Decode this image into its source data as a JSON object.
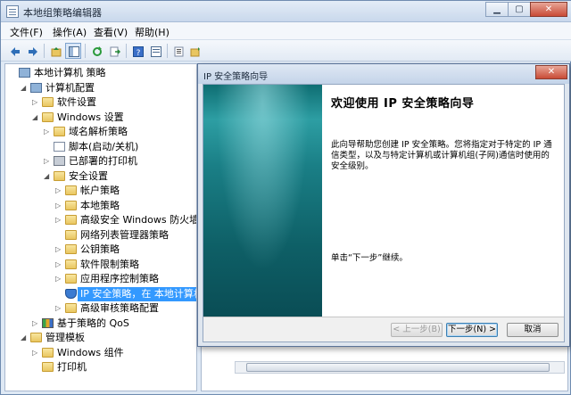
{
  "app": {
    "title": "本地组策略编辑器"
  },
  "window_buttons": {
    "minimize": "▁",
    "maximize": "▢",
    "close": "✕"
  },
  "menu": [
    "文件(F)",
    "操作(A)",
    "查看(V)",
    "帮助(H)"
  ],
  "toolbar": [
    "back-icon",
    "forward-icon",
    "up-folder-icon",
    "show-tree-icon",
    "refresh-icon",
    "export-icon",
    "help-icon",
    "properties-icon",
    "filter-icon",
    "policy-icon"
  ],
  "tree": [
    {
      "label": "本地计算机 策略",
      "icon": "computer-icon",
      "level": 0,
      "arrow": ""
    },
    {
      "label": "计算机配置",
      "icon": "computer-icon",
      "level": 1,
      "arrow": "◢"
    },
    {
      "label": "软件设置",
      "icon": "folder-icon",
      "level": 2,
      "arrow": "▷"
    },
    {
      "label": "Windows 设置",
      "icon": "folder-icon",
      "level": 2,
      "arrow": "◢"
    },
    {
      "label": "域名解析策略",
      "icon": "folder-icon",
      "level": 3,
      "arrow": "▷"
    },
    {
      "label": "脚本(启动/关机)",
      "icon": "doc-icon",
      "level": 3,
      "arrow": ""
    },
    {
      "label": "已部署的打印机",
      "icon": "printer-icon",
      "level": 3,
      "arrow": "▷"
    },
    {
      "label": "安全设置",
      "icon": "folder-icon",
      "level": 3,
      "arrow": "◢"
    },
    {
      "label": "帐户策略",
      "icon": "folder-icon",
      "level": 4,
      "arrow": "▷"
    },
    {
      "label": "本地策略",
      "icon": "folder-icon",
      "level": 4,
      "arrow": "▷"
    },
    {
      "label": "高级安全 Windows 防火墙",
      "icon": "folder-icon",
      "level": 4,
      "arrow": "▷"
    },
    {
      "label": "网络列表管理器策略",
      "icon": "folder-icon",
      "level": 4,
      "arrow": ""
    },
    {
      "label": "公钥策略",
      "icon": "folder-icon",
      "level": 4,
      "arrow": "▷"
    },
    {
      "label": "软件限制策略",
      "icon": "folder-icon",
      "level": 4,
      "arrow": "▷"
    },
    {
      "label": "应用程序控制策略",
      "icon": "folder-icon",
      "level": 4,
      "arrow": "▷"
    },
    {
      "label": "IP 安全策略，在 本地计算机",
      "icon": "shield-icon",
      "level": 4,
      "arrow": "",
      "selected": true
    },
    {
      "label": "高级审核策略配置",
      "icon": "folder-icon",
      "level": 4,
      "arrow": "▷"
    },
    {
      "label": "基于策略的 QoS",
      "icon": "chart-icon",
      "level": 2,
      "arrow": "▷"
    },
    {
      "label": "管理模板",
      "icon": "folder-icon",
      "level": 1,
      "arrow": "◢"
    },
    {
      "label": "Windows 组件",
      "icon": "folder-icon",
      "level": 2,
      "arrow": "▷"
    },
    {
      "label": "打印机",
      "icon": "folder-icon",
      "level": 2,
      "arrow": ""
    }
  ],
  "dialog": {
    "title": "IP 安全策略向导",
    "close": "✕",
    "heading": "欢迎使用 IP 安全策略向导",
    "description": "此向导帮助您创建 IP 安全策略。您将指定对于特定的 IP 通信类型，以及与特定计算机或计算机组(子网)通信时使用的安全级别。",
    "next_hint": "单击“下一步”继续。",
    "buttons": {
      "back": "< 上一步(B)",
      "next": "下一步(N) >",
      "cancel": "取消"
    }
  }
}
